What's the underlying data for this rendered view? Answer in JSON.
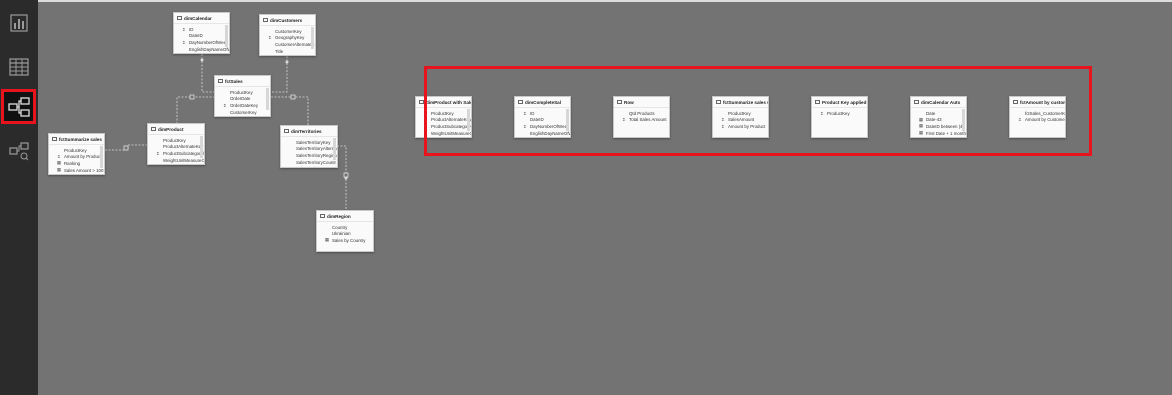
{
  "nav_rail": {
    "items": [
      {
        "name": "report-view",
        "icon": "bar-chart-icon",
        "active": false
      },
      {
        "name": "data-view",
        "icon": "table-grid-icon",
        "active": true
      },
      {
        "name": "model-view",
        "icon": "model-diagram-icon",
        "active": true
      },
      {
        "name": "dax-query-view",
        "icon": "query-view-icon",
        "active": false
      }
    ]
  },
  "colors": {
    "canvas": "#737373",
    "rail": "#2b2b2b",
    "highlight": "#e8141d",
    "card": "#fafafa"
  },
  "tables": {
    "dimCalendar": {
      "title": "dimCalendar",
      "fields": [
        {
          "icon": "Σ",
          "name": "ID"
        },
        {
          "icon": "",
          "name": "DateID"
        },
        {
          "icon": "Σ",
          "name": "DayNumberOfWeek"
        },
        {
          "icon": "",
          "name": "EnglishDayNameOfW"
        },
        {
          "icon": "",
          "name": "EnglishMonthName"
        }
      ]
    },
    "dimCustomers": {
      "title": "dimCustomers",
      "fields": [
        {
          "icon": "",
          "name": "CustomerKey"
        },
        {
          "icon": "Σ",
          "name": "GeographyKey"
        },
        {
          "icon": "",
          "name": "CustomerAlternateK"
        },
        {
          "icon": "",
          "name": "Title"
        }
      ]
    },
    "fctSales": {
      "title": "fctSales",
      "fields": [
        {
          "icon": "",
          "name": "ProductKey"
        },
        {
          "icon": "",
          "name": "OrderDate"
        },
        {
          "icon": "Σ",
          "name": "OrderDateKey"
        },
        {
          "icon": "",
          "name": "CustomerKey"
        },
        {
          "icon": "",
          "name": "SalesTerritoryKey"
        }
      ]
    },
    "fctSummarize": {
      "title": "fctSummarize sales",
      "fields": [
        {
          "icon": "",
          "name": "ProductKey"
        },
        {
          "icon": "Σ",
          "name": "Amount by Product"
        },
        {
          "icon": "▦",
          "name": "Ranking"
        },
        {
          "icon": "▦",
          "name": "Sales Amount > 100"
        }
      ]
    },
    "dimProduct": {
      "title": "dimProduct",
      "fields": [
        {
          "icon": "",
          "name": "ProductKey"
        },
        {
          "icon": "",
          "name": "ProductAlternateKey"
        },
        {
          "icon": "Σ",
          "name": "ProductSubcategoryl"
        },
        {
          "icon": "",
          "name": "WeightUnitMeasureC"
        },
        {
          "icon": "",
          "name": "SizeUnitMeasureCode"
        }
      ]
    },
    "dimTerritories": {
      "title": "dimTerritories",
      "fields": [
        {
          "icon": "",
          "name": "SalesTerritoryKey"
        },
        {
          "icon": "",
          "name": "SalesTerritoryAlternat"
        },
        {
          "icon": "",
          "name": "SalesTerritoryRegion"
        },
        {
          "icon": "",
          "name": "SalesTerritoryCountr"
        },
        {
          "icon": "",
          "name": "SalesTerritoryGroup"
        }
      ]
    },
    "dimRegion": {
      "title": "dimRegion",
      "fields": [
        {
          "icon": "",
          "name": "Country"
        },
        {
          "icon": "",
          "name": "Ukrainian"
        },
        {
          "icon": "▦",
          "name": "Sales by Country"
        }
      ]
    },
    "dimProductFiltered": {
      "title": "dimProduct with Sales",
      "fields": [
        {
          "icon": "",
          "name": "ProductKey"
        },
        {
          "icon": "",
          "name": "ProductAlternateKey"
        },
        {
          "icon": "",
          "name": "ProductSubcategory"
        },
        {
          "icon": "",
          "name": "WeightUnitMeasureC"
        }
      ]
    },
    "dimCalendarCopy": {
      "title": "dimCompleteSal",
      "fields": [
        {
          "icon": "Σ",
          "name": "ID"
        },
        {
          "icon": "",
          "name": "DateID"
        },
        {
          "icon": "Σ",
          "name": "DayNumberOfWeek"
        },
        {
          "icon": "",
          "name": "EnglishDayNameOfW"
        }
      ]
    },
    "row": {
      "title": "Row",
      "fields": [
        {
          "icon": "",
          "name": "Qtd Products"
        },
        {
          "icon": "Σ",
          "name": "Total Sales Amount"
        }
      ]
    },
    "fctSummarizeCopy": {
      "title": "fctSummarize sales with",
      "fields": [
        {
          "icon": "",
          "name": "ProductKey"
        },
        {
          "icon": "Σ",
          "name": "SalesAmount"
        },
        {
          "icon": "Σ",
          "name": "Amount by Product"
        }
      ]
    },
    "productKey": {
      "title": "Product Key applied to r",
      "fields": [
        {
          "icon": "Σ",
          "name": "ProductKey"
        }
      ]
    },
    "dimCalendarAuto": {
      "title": "dimCalendar Auto",
      "fields": [
        {
          "icon": "",
          "name": "Date"
        },
        {
          "icon": "▦",
          "name": "Date-43"
        },
        {
          "icon": "▦",
          "name": "DateID between (4)"
        },
        {
          "icon": "▦",
          "name": "First Date + 1 month"
        }
      ]
    },
    "fctAmount": {
      "title": "fctAmount by customer",
      "fields": [
        {
          "icon": "",
          "name": "fctSales_CustomerKey"
        },
        {
          "icon": "Σ",
          "name": "Amount by Customer"
        }
      ]
    }
  }
}
